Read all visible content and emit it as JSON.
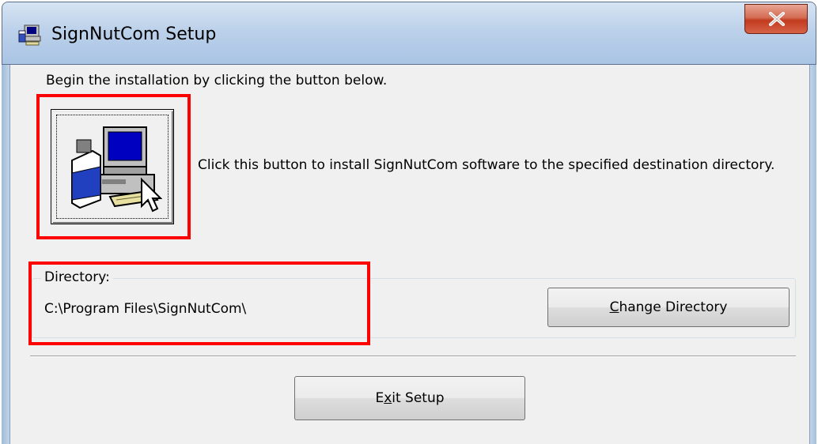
{
  "window": {
    "title": "SignNutCom Setup",
    "close_label": "X"
  },
  "main": {
    "intro_text": "Begin the installation by clicking the button below.",
    "install_description": "Click this button to install SignNutCom software to the specified destination directory."
  },
  "directory": {
    "group_label": "Directory:",
    "path": "C:\\Program Files\\SignNutCom\\",
    "change_button": {
      "mnemonic": "C",
      "rest": "hange Directory"
    }
  },
  "exit_button": {
    "before": "E",
    "mnemonic": "x",
    "after": "it Setup"
  },
  "icons": {
    "app": "setup-app-icon",
    "install": "computer-install-icon",
    "close": "close-icon"
  },
  "colors": {
    "highlight": "#ff0000",
    "dialog_bg": "#f0f0f0",
    "close_button": "#c23b1f"
  }
}
